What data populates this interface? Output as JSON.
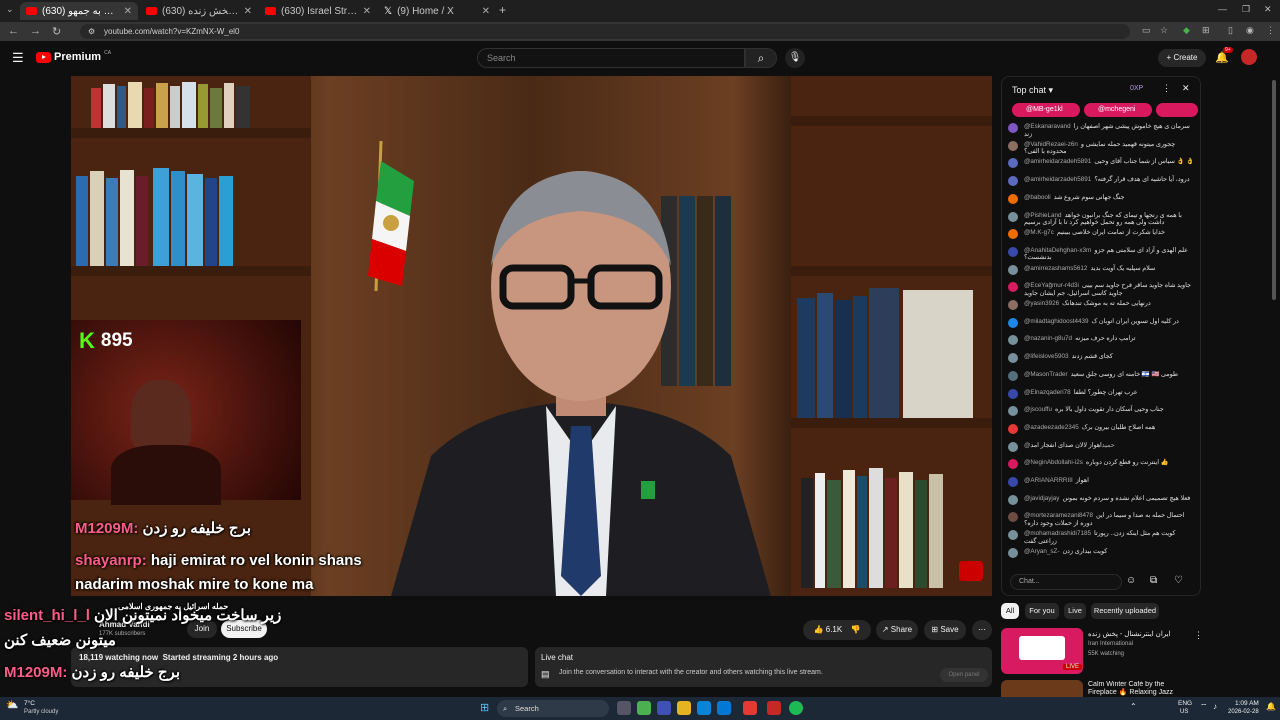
{
  "browser": {
    "tabs": [
      {
        "title": "(630) حمله اسرائیل به جمهو..."
      },
      {
        "title": "(630) ایران اینترنشنال - پخش زنده"
      },
      {
        "title": "(630) Israel Strikes Iran LIVE | El..."
      },
      {
        "title": "(9) Home / X"
      }
    ],
    "new_tab": "+",
    "url": "youtube.com/watch?v=KZmNX-W_el0"
  },
  "youtube": {
    "logo_text": "Premium",
    "logo_region": "CA",
    "search_placeholder": "Search",
    "create_label": "Create",
    "notif_count": "9+"
  },
  "video": {
    "kick_count": "895",
    "overlay_lines": [
      {
        "user": "M1209M:",
        "text": "برج خلیفه رو زدن"
      },
      {
        "user": "shayanrp:",
        "text": "haji emirat ro vel konin shans"
      },
      {
        "user": "",
        "text": "nadarim moshak mire to kone ma"
      },
      {
        "user": "silent_hi_l_l",
        "text": "زیر ساخت میخواد نمیتونن الان"
      },
      {
        "user": "",
        "text": "میتونن ضعیف کنن"
      },
      {
        "user": "M1209M:",
        "text": "برج خلیفه رو زدن"
      }
    ],
    "title_overlay": "حمله اسرائیل به جمهوری اسلامی"
  },
  "below_video": {
    "channel_name": "Ahmad Vahdi",
    "subscribers": "177K subscribers",
    "join_label": "Join",
    "subscribe_label": "Subscribe",
    "like_count": "6.1K",
    "share_label": "Share",
    "save_label": "Save",
    "watching": "18,119 watching now",
    "started": "Started streaming 2 hours ago",
    "live_chat_title": "Live chat",
    "live_chat_text": "Join the conversation to interact with the creator and others watching this live stream.",
    "open_panel": "Open panel"
  },
  "chat": {
    "header": "Top chat",
    "xp": "0XP",
    "pinned": [
      "@MB-ge1kl",
      "@mchegeni"
    ],
    "input_placeholder": "Chat...",
    "messages": [
      {
        "user": "@Eskanaravand",
        "text": "سرمان ی هیچ خاموش پیشی شهر اصفهان را زند",
        "color": "#7e57c2"
      },
      {
        "user": "@VahidRezaei-z6n",
        "text": "چجوری میتونه قهمید حمله نمایشی و محدوده با الفی؟",
        "color": "#8d6e63"
      },
      {
        "user": "@amirheidarzadeh5891",
        "text": "سیاس از شما جناب آقای وحیی 👌 👌",
        "color": "#5c6bc0"
      },
      {
        "user": "@amirheidarzadeh5891",
        "text": "درود، آیا حاشیه ای هدف قرار گرفته؟",
        "color": "#5c6bc0"
      },
      {
        "user": "@babooli",
        "text": "جنگ جهانی سوم شروع شد",
        "color": "#ef6c00"
      },
      {
        "user": "@PishieLand",
        "text": "با همه ی رنجها و تیمای که جنگ برانبون خواهد داشت ولی همه رو تحمل خواهیم کرد تا با آزادی برسیم",
        "color": "#78909c"
      },
      {
        "user": "@M.K-g7c",
        "text": "خدایا شکرت از تمامت ایران خلاصی ببینیم",
        "color": "#ef6c00"
      },
      {
        "user": "@AnahitaDehghan-x3m",
        "text": "علم الهدی و آزاد ای سلامتی هم جزو بدنشست؟",
        "color": "#3949ab"
      },
      {
        "user": "@amirrezashams5612",
        "text": "سلام سپلیه یک آویت بدید",
        "color": "#78909c"
      },
      {
        "user": "@EceYağmur-r4d3i",
        "text": "جاوید شاه جاوید ساقر فرح جاوید سم بیبی جاوید کاسی اسرائیل، جم ایشان جاوید",
        "color": "#d81b60"
      },
      {
        "user": "@yasin3926",
        "text": "درنهایی حمله ته به موشک تندهانک",
        "color": "#8d6e63"
      },
      {
        "user": "@miladtaghidoost4439",
        "text": "در کلیه اول تسوین ایران اتوبان ک",
        "color": "#1e88e5"
      },
      {
        "user": "@nazanin-g8u7d",
        "text": "ترامپ داره حرف میزنه",
        "color": "#78909c"
      },
      {
        "user": "@lifeislove5903",
        "text": "کجای قشم زدند",
        "color": "#78909c"
      },
      {
        "user": "@MasonTrader",
        "text": "خامنه ای روسی جلق سعید 🇮🇱 🇺🇸 طومی",
        "color": "#546e7a"
      },
      {
        "user": "@Elnazqaderi78",
        "text": "عرب تهران چطور؟ لطفا",
        "color": "#3949ab"
      },
      {
        "user": "@jscouffu",
        "text": "جناب وحیی آسکان دار تقویت داول بالا بره",
        "color": "#78909c"
      },
      {
        "user": "@azadeezade2345",
        "text": "همه اصلاح طلبان بیرون برک",
        "color": "#e53935"
      },
      {
        "user": "@حمید",
        "text": "اهواز لالان صدای انفجار امد",
        "color": "#78909c"
      },
      {
        "user": "@NeginAbdollahi-i2s",
        "text": "اینترنت رو قطع کردن دوباره 👍",
        "color": "#d81b60"
      },
      {
        "user": "@ARIANARRRIII",
        "text": "اهواز",
        "color": "#3949ab"
      },
      {
        "user": "@javidjayjay",
        "text": "فعلا هیچ تصمیمی اعلام نشده و سردم خونه بمونن",
        "color": "#78909c"
      },
      {
        "user": "@mortezaramezani8478",
        "text": "احتمال حمله به صدا و سیما در این دوره از حملات وجود داره؟",
        "color": "#6d4c41"
      },
      {
        "user": "@mohamadrashidi7185",
        "text": "کویت هم مثل اینکه زدن.. رپورتا زراعتی گفت",
        "color": "#78909c"
      },
      {
        "user": "@Aryan_sZ-",
        "text": "کویت بیداری زدن",
        "color": "#78909c"
      }
    ]
  },
  "right_col": {
    "chips": [
      "All",
      "For you",
      "Live",
      "Recently uploaded"
    ],
    "rec1_title": "ایران اینترنشنال - پخش زنده",
    "rec1_channel": "Iran International",
    "rec1_watching": "55K watching",
    "rec1_badge": "LIVE",
    "rec2_title": "Calm Winter Café by the Fireplace 🔥 Relaxing Jazz"
  },
  "taskbar": {
    "weather_temp": "7°C",
    "weather_desc": "Partly cloudy",
    "search_label": "Search",
    "lang": "ENG",
    "lang2": "US",
    "time": "1:09 AM",
    "date": "2026-02-28"
  }
}
